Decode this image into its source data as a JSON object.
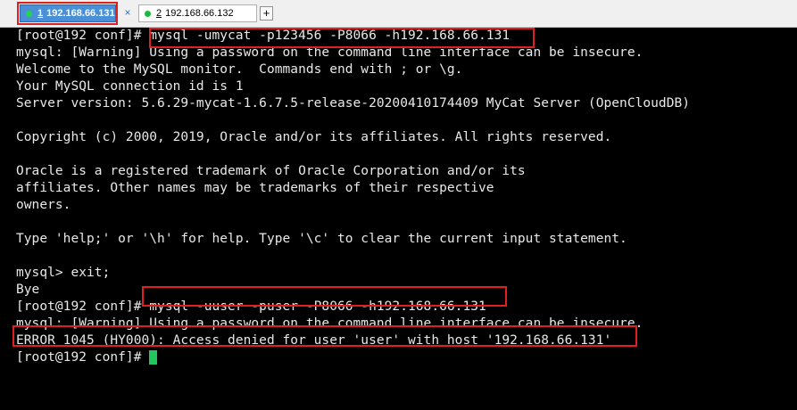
{
  "tabs": [
    {
      "number": "1",
      "label": "192.168.66.131",
      "active": true
    },
    {
      "number": "2",
      "label": "192.168.66.132",
      "active": false
    }
  ],
  "tab_close_symbol": "×",
  "tab_add_symbol": "+",
  "colors": {
    "highlight": "#e0201e",
    "active_tab": "#4a90d9",
    "cursor": "#22c55e",
    "status_dot": "#1fb83b"
  },
  "terminal": {
    "lines": [
      "[root@192 conf]# mysql -umycat -p123456 -P8066 -h192.168.66.131",
      "mysql: [Warning] Using a password on the command line interface can be insecure.",
      "Welcome to the MySQL monitor.  Commands end with ; or \\g.",
      "Your MySQL connection id is 1",
      "Server version: 5.6.29-mycat-1.6.7.5-release-20200410174409 MyCat Server (OpenCloudDB)",
      "",
      "Copyright (c) 2000, 2019, Oracle and/or its affiliates. All rights reserved.",
      "",
      "Oracle is a registered trademark of Oracle Corporation and/or its",
      "affiliates. Other names may be trademarks of their respective",
      "owners.",
      "",
      "Type 'help;' or '\\h' for help. Type '\\c' to clear the current input statement.",
      "",
      "mysql> exit;",
      "Bye",
      "[root@192 conf]# mysql -uuser -puser -P8066 -h192.168.66.131",
      "mysql: [Warning] Using a password on the command line interface can be insecure.",
      "ERROR 1045 (HY000): Access denied for user 'user' with host '192.168.66.131'",
      "[root@192 conf]# "
    ]
  }
}
